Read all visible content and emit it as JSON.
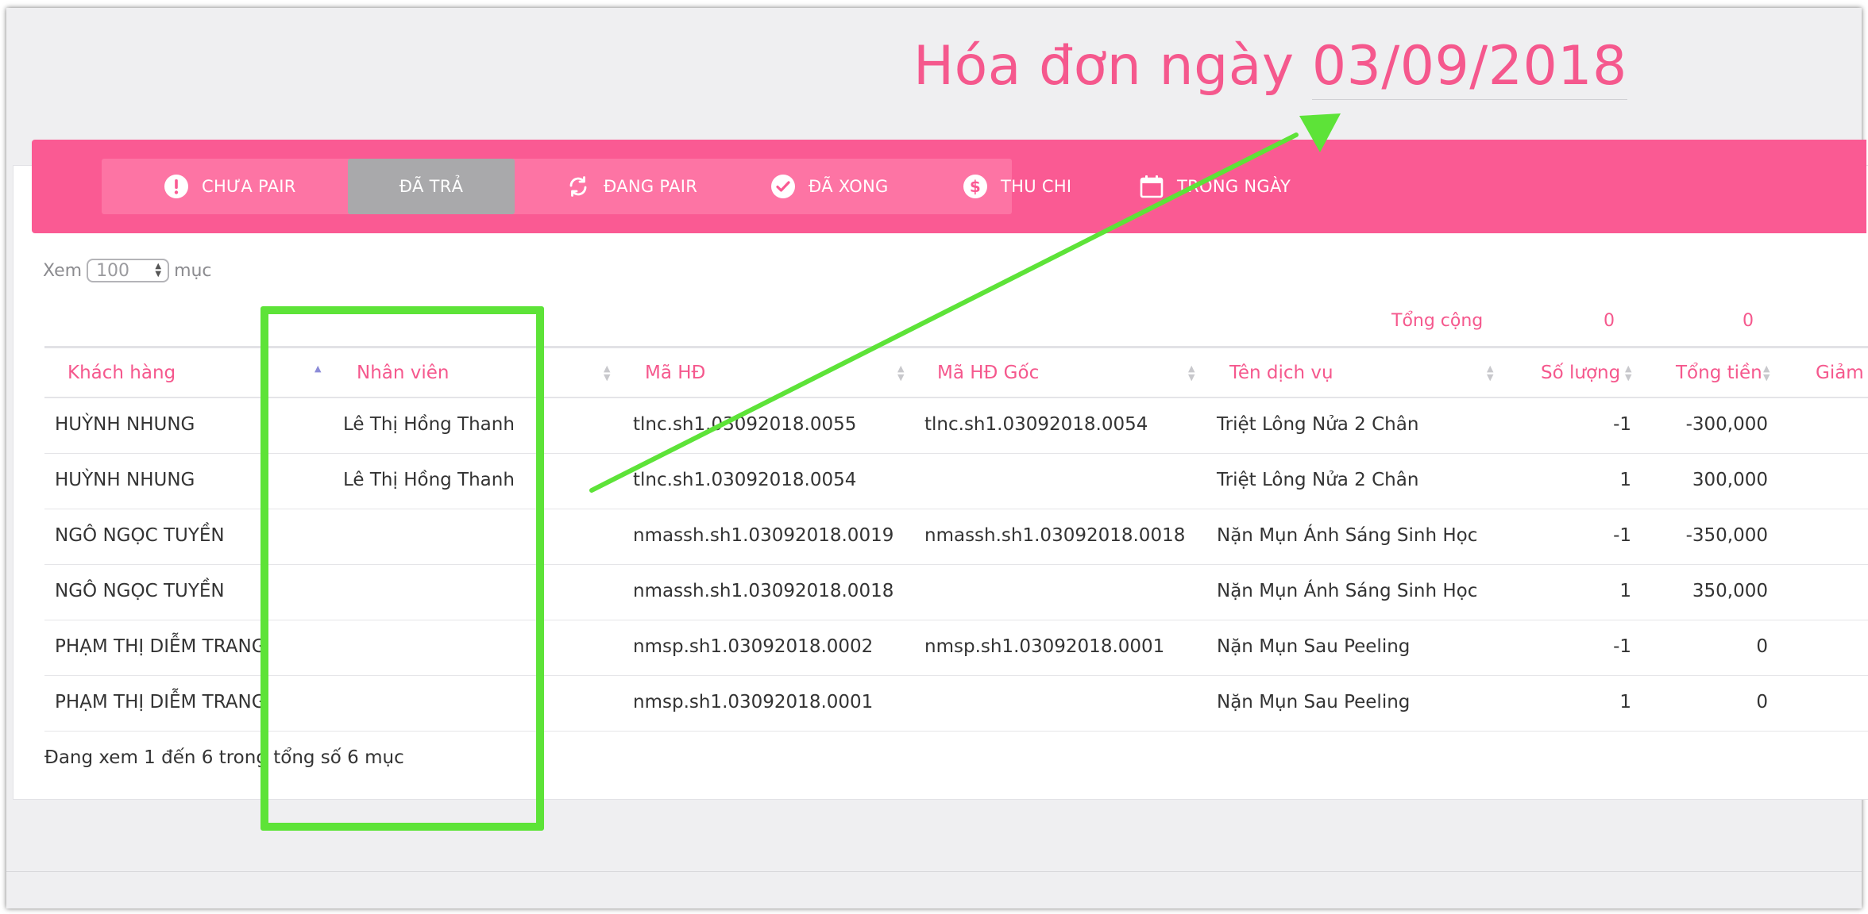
{
  "page": {
    "title_prefix": "Hóa đơn ngày",
    "title_date": "03/09/2018"
  },
  "tabs": [
    {
      "label": "CHƯA PAIR",
      "icon": "exclamation-circle-icon",
      "active": false
    },
    {
      "label": "ĐÃ TRẢ",
      "icon": "",
      "active": true
    },
    {
      "label": "ĐANG PAIR",
      "icon": "sync-icon",
      "active": false
    },
    {
      "label": "ĐÃ XONG",
      "icon": "check-circle-icon",
      "active": false
    },
    {
      "label": "THU CHI",
      "icon": "dollar-circle-icon",
      "active": false
    },
    {
      "label": "TRONG NGÀY",
      "icon": "calendar-icon",
      "active": false
    }
  ],
  "length_control": {
    "prefix": "Xem",
    "value": "100",
    "suffix": "mục"
  },
  "totals": {
    "label": "Tổng cộng",
    "so_luong": "0",
    "tong_tien": "0"
  },
  "table": {
    "columns": [
      "Khách hàng",
      "Nhân viên",
      "Mã HĐ",
      "Mã HĐ Gốc",
      "Tên dịch vụ",
      "Số lượng",
      "Tổng tiền",
      "Giảm"
    ],
    "rows": [
      [
        "HUỲNH NHUNG",
        "Lê Thị Hồng Thanh",
        "tlnc.sh1.03092018.0055",
        "tlnc.sh1.03092018.0054",
        "Triệt Lông Nửa 2 Chân",
        "-1",
        "-300,000"
      ],
      [
        "HUỲNH NHUNG",
        "Lê Thị Hồng Thanh",
        "tlnc.sh1.03092018.0054",
        "",
        "Triệt Lông Nửa 2 Chân",
        "1",
        "300,000"
      ],
      [
        "NGÔ NGỌC TUYỀN",
        "",
        "nmassh.sh1.03092018.0019",
        "nmassh.sh1.03092018.0018",
        "Nặn Mụn Ánh Sáng Sinh Học",
        "-1",
        "-350,000"
      ],
      [
        "NGÔ NGỌC TUYỀN",
        "",
        "nmassh.sh1.03092018.0018",
        "",
        "Nặn Mụn Ánh Sáng Sinh Học",
        "1",
        "350,000"
      ],
      [
        "PHẠM THỊ DIỄM TRANG",
        "",
        "nmsp.sh1.03092018.0002",
        "nmsp.sh1.03092018.0001",
        "Nặn Mụn Sau Peeling",
        "-1",
        "0"
      ],
      [
        "PHẠM THỊ DIỄM TRANG",
        "",
        "nmsp.sh1.03092018.0001",
        "",
        "Nặn Mụn Sau Peeling",
        "1",
        "0"
      ]
    ]
  },
  "info": "Đang xem 1 đến 6 trong tổng số 6 mục",
  "colors": {
    "accent": "#fa5a93",
    "accent_text": "#f5588d",
    "active_tab": "#a9a9ab",
    "annotation": "#5de338"
  }
}
